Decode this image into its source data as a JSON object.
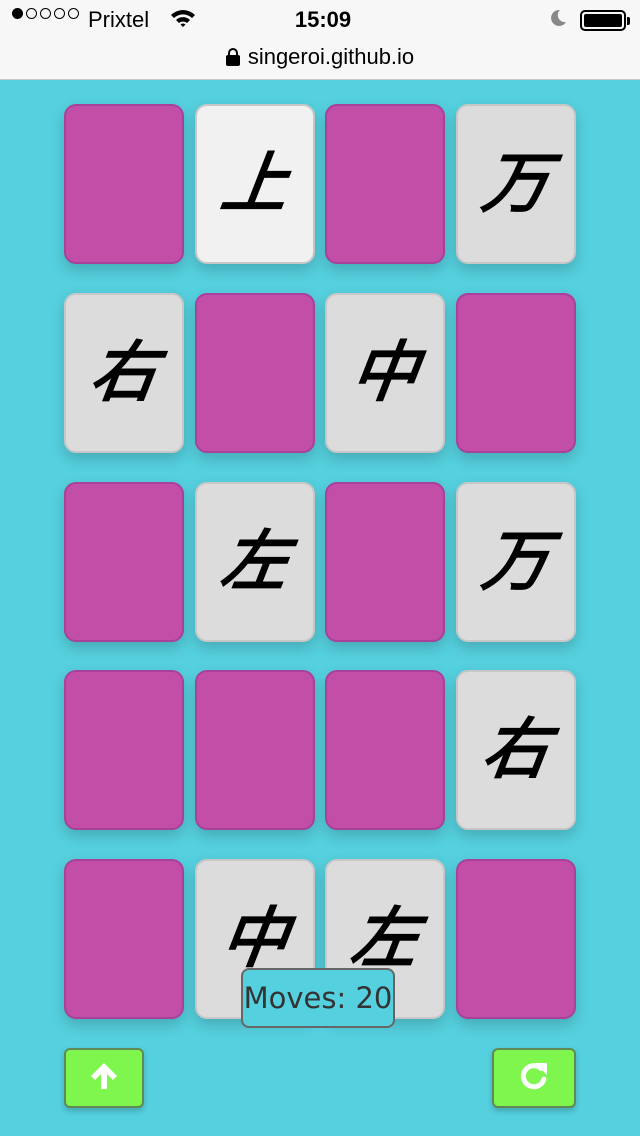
{
  "status_bar": {
    "carrier": "Prixtel",
    "time": "15:09",
    "signal_bars_filled": 1,
    "signal_bars_total": 5
  },
  "browser": {
    "url": "singeroi.github.io"
  },
  "colors": {
    "background": "#55d0de",
    "card_back": "#c24ea8",
    "card_face": "#dcdcdc",
    "button": "#7ef64e"
  },
  "board": {
    "rows": [
      [
        {
          "state": "back",
          "char": ""
        },
        {
          "state": "face",
          "char": "上"
        },
        {
          "state": "back",
          "char": ""
        },
        {
          "state": "face",
          "char": "万"
        }
      ],
      [
        {
          "state": "face",
          "char": "右"
        },
        {
          "state": "back",
          "char": ""
        },
        {
          "state": "face",
          "char": "中"
        },
        {
          "state": "back",
          "char": ""
        }
      ],
      [
        {
          "state": "back",
          "char": ""
        },
        {
          "state": "face",
          "char": "左"
        },
        {
          "state": "back",
          "char": ""
        },
        {
          "state": "face",
          "char": "万"
        }
      ],
      [
        {
          "state": "back",
          "char": ""
        },
        {
          "state": "back",
          "char": ""
        },
        {
          "state": "back",
          "char": ""
        },
        {
          "state": "face",
          "char": "右"
        }
      ],
      [
        {
          "state": "back",
          "char": ""
        },
        {
          "state": "face",
          "char": "中"
        },
        {
          "state": "face",
          "char": "左"
        },
        {
          "state": "back",
          "char": ""
        }
      ]
    ]
  },
  "controls": {
    "moves_label": "Moves: 20",
    "up_button_icon": "arrow-up-icon",
    "restart_button_icon": "restart-icon"
  }
}
